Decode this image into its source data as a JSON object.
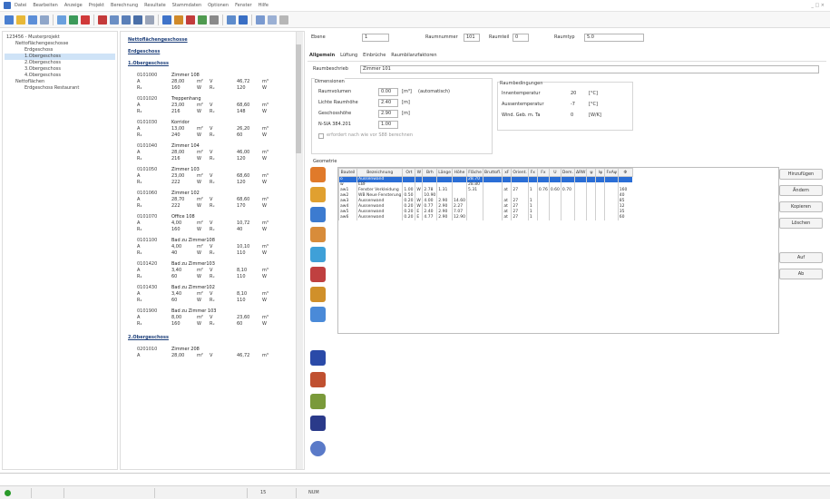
{
  "menu": [
    "Datei",
    "Bearbeiten",
    "Anzeige",
    "Projekt",
    "Berechnung",
    "Resultate",
    "Stammdaten",
    "Optionen",
    "Fenster",
    "Hilfe"
  ],
  "window_controls": "_ □ ×",
  "tree": [
    {
      "label": "123456 - Musterprojekt",
      "sel": false,
      "indent": 0
    },
    {
      "label": "Nettoflächengeschosse",
      "sel": false,
      "indent": 1
    },
    {
      "label": "Erdgeschoss",
      "sel": false,
      "indent": 2
    },
    {
      "label": "1.Obergeschoss",
      "sel": true,
      "indent": 2
    },
    {
      "label": "2.Obergeschoss",
      "sel": false,
      "indent": 2
    },
    {
      "label": "3.Obergeschoss",
      "sel": false,
      "indent": 2
    },
    {
      "label": "4.Obergeschoss",
      "sel": false,
      "indent": 2
    },
    {
      "label": "Nettoflächen",
      "sel": false,
      "indent": 1
    },
    {
      "label": "Erdgeschoss Restaurant",
      "sel": false,
      "indent": 2
    }
  ],
  "floor": {
    "heading": "Nettoflächengeschosse",
    "eg": "Erdgeschoss",
    "og1": "1.Obergeschoss",
    "og2": "2.Obergeschoss",
    "rooms": [
      {
        "nr": "0101000",
        "name": "Zimmer 108",
        "a": "28,00",
        "v": "46,72",
        "b": "160",
        "c": "120"
      },
      {
        "nr": "0101020",
        "name": "Treppenhang",
        "a": "23,00",
        "v": "68,60",
        "b": "216",
        "c": "148"
      },
      {
        "nr": "0101030",
        "name": "Korridor",
        "a": "13,00",
        "v": "26,20",
        "b": "240",
        "c": "60"
      },
      {
        "nr": "0101040",
        "name": "Zimmer 104",
        "a": "28,00",
        "v": "46,00",
        "b": "216",
        "c": "120"
      },
      {
        "nr": "0101050",
        "name": "Zimmer 103",
        "a": "23,00",
        "v": "68,60",
        "b": "222",
        "c": "120"
      },
      {
        "nr": "0101060",
        "name": "Zimmer 102",
        "a": "28,70",
        "v": "68,60",
        "b": "222",
        "c": "170"
      },
      {
        "nr": "0101070",
        "name": "Office 108",
        "a": "4,00",
        "v": "10,72",
        "b": "160",
        "c": "40"
      },
      {
        "nr": "0101100",
        "name": "Bad zu Zimmer108",
        "a": "4,00",
        "v": "10,10",
        "b": "40",
        "c": "110"
      },
      {
        "nr": "0101420",
        "name": "Bad zu Zimmer103",
        "a": "3,40",
        "v": "8,10",
        "b": "60",
        "c": "110"
      },
      {
        "nr": "0101430",
        "name": "Bad zu Zimmer102",
        "a": "3,40",
        "v": "8,10",
        "b": "60",
        "c": "110"
      },
      {
        "nr": "0101900",
        "name": "Bad zu Zimmer 103",
        "a": "8,00",
        "v": "23,60",
        "b": "160",
        "c": "60"
      }
    ],
    "last_room": {
      "nr": "0201010",
      "name": "Zimmer 208",
      "a": "28,00",
      "v": "46,72"
    }
  },
  "panel": {
    "ebene_label": "Ebene",
    "ebene_val": "1",
    "raumnummer_label": "Raumnummer",
    "raumnummer_val": "101",
    "raumteil_label": "Raumteil",
    "raumteil_val": "0",
    "raumtyp_label": "Raumtyp",
    "raumtyp_val": "5.0",
    "tabs": [
      "Allgemein",
      "Lüftung",
      "Einbrüche",
      "Raumbilanzfaktoren"
    ],
    "raumbez_label": "Raumbeschrieb",
    "raumbez_val": "Zimmer 101",
    "g1_title": "Dimensionen",
    "raumvol_label": "Raumvolumen",
    "raumvol_val": "0.00",
    "raumvol_unit": "[m³]",
    "raumvol_note": "(automatisch)",
    "lichte_label": "Lichte Raumhöhe",
    "lichte_val": "2.40",
    "lichte_unit": "[m]",
    "gesch_label": "Geschosshöhe",
    "gesch_val": "2.90",
    "gesch_unit": "[m]",
    "nsia_label": "N-SIA 384.201",
    "nsia_val": "1.00",
    "chk_label": "erfordert nach wie vor S88 berechnen",
    "g2_title": "Raumbedingungen",
    "r1_label": "Innentemperatur",
    "r1_val": "20",
    "r1_unit": "[°C]",
    "r2_label": "Aussentemperatur",
    "r2_val": "-7",
    "r2_unit": "[°C]",
    "r3_label": "Wind. Geb. m. Ta",
    "r3_val": "0",
    "r3_unit": "[W/K]",
    "g3_title": "Geometrie"
  },
  "grid": {
    "headers": [
      "Bauteil",
      "Bezeichnung",
      "Ort",
      "W",
      "Brh",
      "Länge",
      "Höhe",
      "Fläche",
      "Bruttofl.",
      "xF",
      "Orient.",
      "Fx",
      "Fx",
      "U",
      "Dem.",
      "ΔRW",
      "ψ",
      "lψ",
      "FxAψ",
      "Φ"
    ],
    "rows": [
      {
        "sel": true,
        "c": [
          "o",
          "Aussenwand",
          "",
          "",
          "",
          "",
          "",
          "28.70",
          "",
          "",
          "",
          "",
          "",
          "",
          "",
          "",
          "",
          "",
          "",
          ""
        ]
      },
      {
        "sel": false,
        "c": [
          "w",
          "EBF",
          "",
          "",
          "",
          "",
          "",
          "28.80",
          "",
          "",
          "",
          "",
          "",
          "",
          "",
          "",
          "",
          "",
          "",
          ""
        ]
      },
      {
        "sel": false,
        "c": [
          "aw1",
          "Fenster Verkleidung",
          "1.00",
          "W",
          "2.78",
          "1.31",
          "",
          "5.31",
          "",
          "at",
          "27",
          "1",
          "0.76",
          "0.60",
          "0.70",
          "",
          "",
          "",
          "",
          "160"
        ]
      },
      {
        "sel": false,
        "c": [
          "aw2",
          "WB Neue Fensterung",
          "0.50",
          "",
          "10.90",
          "",
          "",
          "",
          "",
          "",
          "",
          "",
          "",
          "",
          "",
          "",
          "",
          "",
          "",
          "40"
        ]
      },
      {
        "sel": false,
        "c": [
          "aw3",
          "Aussenwand",
          "0.20",
          "W",
          "4.00",
          "2.90",
          "14.60",
          "",
          "",
          "at",
          "27",
          "1",
          "",
          "",
          "",
          "",
          "",
          "",
          "",
          "85"
        ]
      },
      {
        "sel": false,
        "c": [
          "aw4",
          "Aussenwand",
          "0.20",
          "W",
          "0.77",
          "2.90",
          "2.27",
          "",
          "",
          "at",
          "27",
          "1",
          "",
          "",
          "",
          "",
          "",
          "",
          "",
          "12"
        ]
      },
      {
        "sel": false,
        "c": [
          "aw5",
          "Aussenwand",
          "0.20",
          "E",
          "2.40",
          "2.90",
          "7.07",
          "",
          "",
          "at",
          "27",
          "1",
          "",
          "",
          "",
          "",
          "",
          "",
          "",
          "35"
        ]
      },
      {
        "sel": false,
        "c": [
          "aw6",
          "Aussenwand",
          "0.20",
          "E",
          "4.77",
          "2.90",
          "12.90",
          "",
          "",
          "at",
          "27",
          "1",
          "",
          "",
          "",
          "",
          "",
          "",
          "",
          "60"
        ]
      }
    ]
  },
  "buttons": [
    "Hinzufügen",
    "Ändern",
    "Kopieren",
    "Löschen",
    "Auf",
    "Ab"
  ],
  "status": {
    "page": "15",
    "mode": "NUM"
  }
}
